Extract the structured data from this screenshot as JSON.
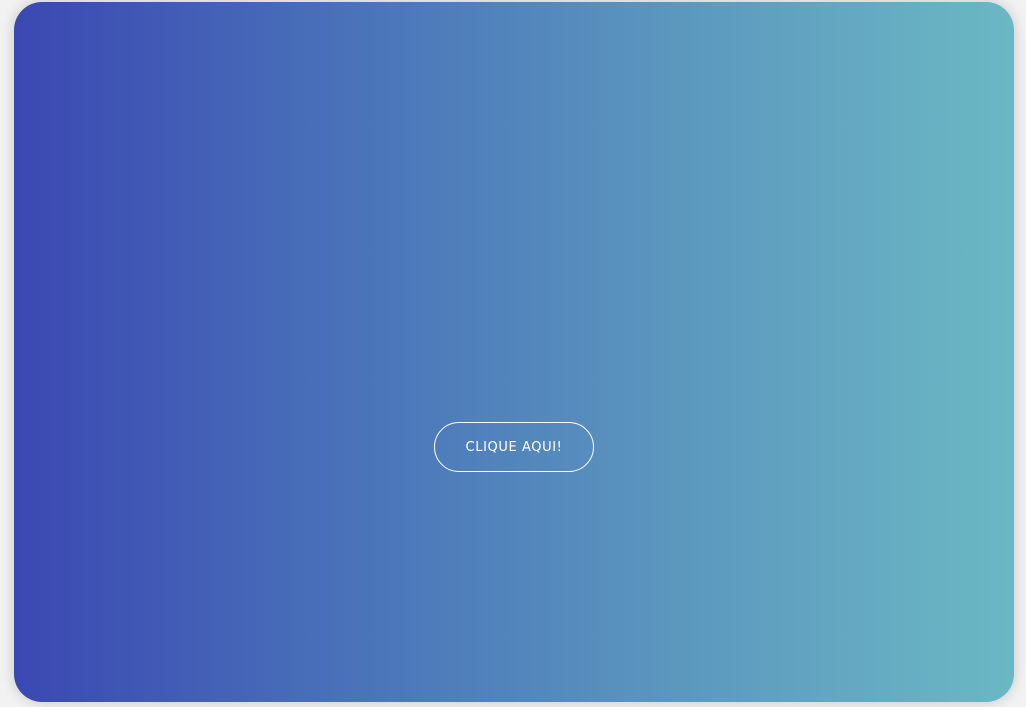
{
  "card": {
    "gradient_start": "#3b48b2",
    "gradient_end": "#6bb8c4"
  },
  "cta": {
    "label": "CLIQUE AQUI!",
    "border_color": "#ffffff",
    "text_color": "#ffffff"
  }
}
